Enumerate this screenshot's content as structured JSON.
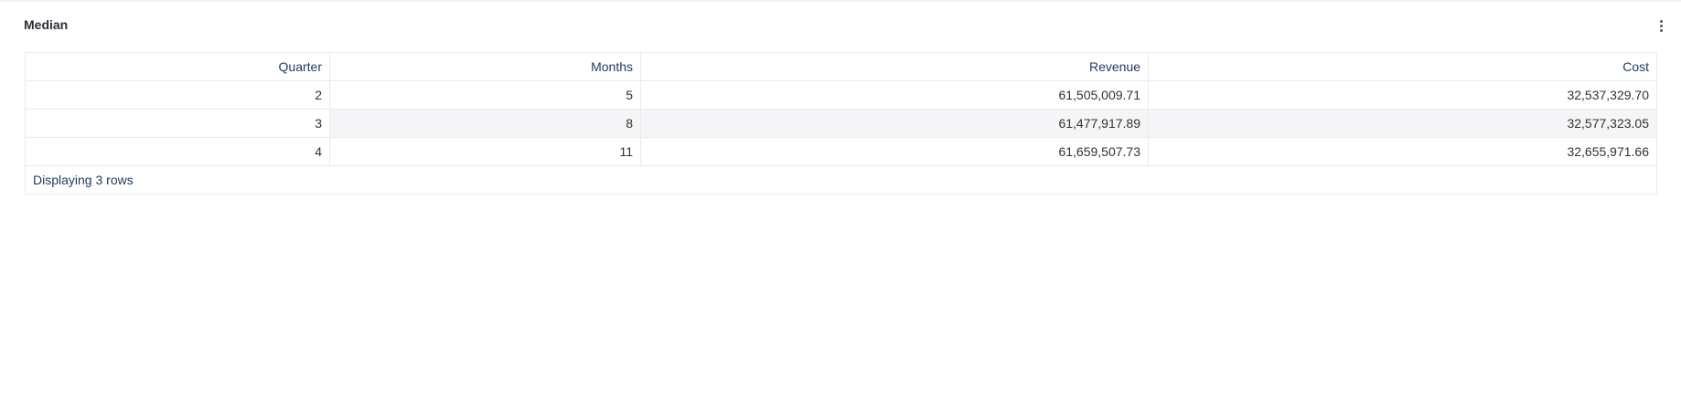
{
  "panel": {
    "title": "Median",
    "menu_icon": "kebab-vertical-icon"
  },
  "table": {
    "columns": [
      "Quarter",
      "Months",
      "Revenue",
      "Cost"
    ],
    "rows": [
      [
        "2",
        "5",
        "61,505,009.71",
        "32,537,329.70"
      ],
      [
        "3",
        "8",
        "61,477,917.89",
        "32,577,323.05"
      ],
      [
        "4",
        "11",
        "61,659,507.73",
        "32,655,971.66"
      ]
    ],
    "footer": "Displaying 3 rows"
  }
}
